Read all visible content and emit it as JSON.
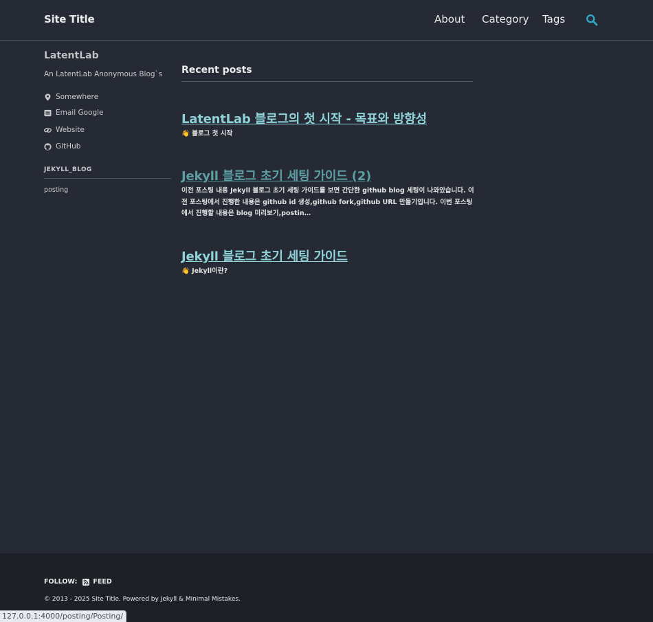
{
  "header": {
    "site_title": "Site Title",
    "nav": [
      "About",
      "Category",
      "Tags"
    ],
    "search_icon": "search-icon",
    "accent": "#30a9c7"
  },
  "sidebar": {
    "author_name": "LatentLab",
    "bio": "An LatentLab Anonymous Blog`s",
    "links": [
      {
        "icon": "map-marker-icon",
        "label": "Somewhere"
      },
      {
        "icon": "envelope-icon",
        "label": "Email Google"
      },
      {
        "icon": "link-icon",
        "label": "Website"
      },
      {
        "icon": "github-icon",
        "label": "GitHub"
      }
    ],
    "nav_heading": "JEKYLL_BLOG",
    "nav_items": [
      "posting"
    ]
  },
  "main": {
    "section_title": "Recent posts",
    "posts": [
      {
        "title": "LatentLab 블로그의 첫 시작 - 목표와 방향성",
        "excerpt": "👋 블로그 첫 시작"
      },
      {
        "title": "Jekyll 블로그 초기 세팅 가이드 (2)",
        "excerpt": "이전 포스팅 내용 Jekyll 블로그 초기 세팅 가이드를 보면 간단한 github blog 세팅이 나와있습니다. 이전 포스팅에서 진행한 내용은 github id 생성,github fork,github URL 만들기입니다. 이번 포스팅에서 진행할 내용은 blog 미리보기,postin…"
      },
      {
        "title": "Jekyll 블로그 초기 세팅 가이드",
        "excerpt": "👋 Jekyll이란?"
      }
    ],
    "link_color": "#8fd3d8",
    "visited_link_color": "#5d9ea3"
  },
  "footer": {
    "follow_label": "FOLLOW:",
    "feed_label": "FEED",
    "feed_icon": "rss-icon",
    "copyright": "© 2013 - 2025 Site Title. Powered by Jekyll & Minimal Mistakes."
  },
  "status_bar": {
    "url": "127.0.0.1:4000/posting/Posting/"
  }
}
